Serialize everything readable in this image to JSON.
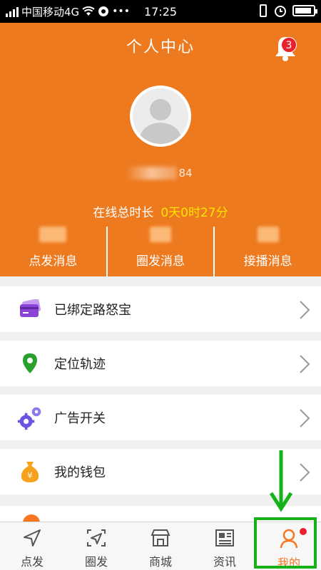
{
  "statusbar": {
    "carrier": "中国移动4G",
    "time": "17:25"
  },
  "header": {
    "title": "个人中心",
    "bell_badge": "3",
    "username_suffix": "84",
    "online_label": "在线总时长",
    "online_value": "0天0时27分",
    "stats": [
      {
        "label": "点发消息"
      },
      {
        "label": "圈发消息"
      },
      {
        "label": "接播消息"
      }
    ]
  },
  "menu": {
    "items": [
      {
        "label": "已绑定路怒宝",
        "icon": "card-icon"
      },
      {
        "label": "定位轨迹",
        "icon": "location-pin-icon"
      },
      {
        "label": "广告开关",
        "icon": "gears-icon"
      },
      {
        "label": "我的钱包",
        "icon": "money-bag-icon"
      }
    ]
  },
  "tabbar": {
    "tabs": [
      {
        "label": "点发",
        "icon": "send-icon"
      },
      {
        "label": "圈发",
        "icon": "circle-send-icon"
      },
      {
        "label": "商城",
        "icon": "store-icon"
      },
      {
        "label": "资讯",
        "icon": "news-icon"
      },
      {
        "label": "我的",
        "icon": "person-icon",
        "active": true
      }
    ]
  },
  "colors": {
    "accent": "#ee7a1f",
    "highlight": "#17b21a",
    "online_value": "#ffe400",
    "badge": "#e8212d"
  }
}
